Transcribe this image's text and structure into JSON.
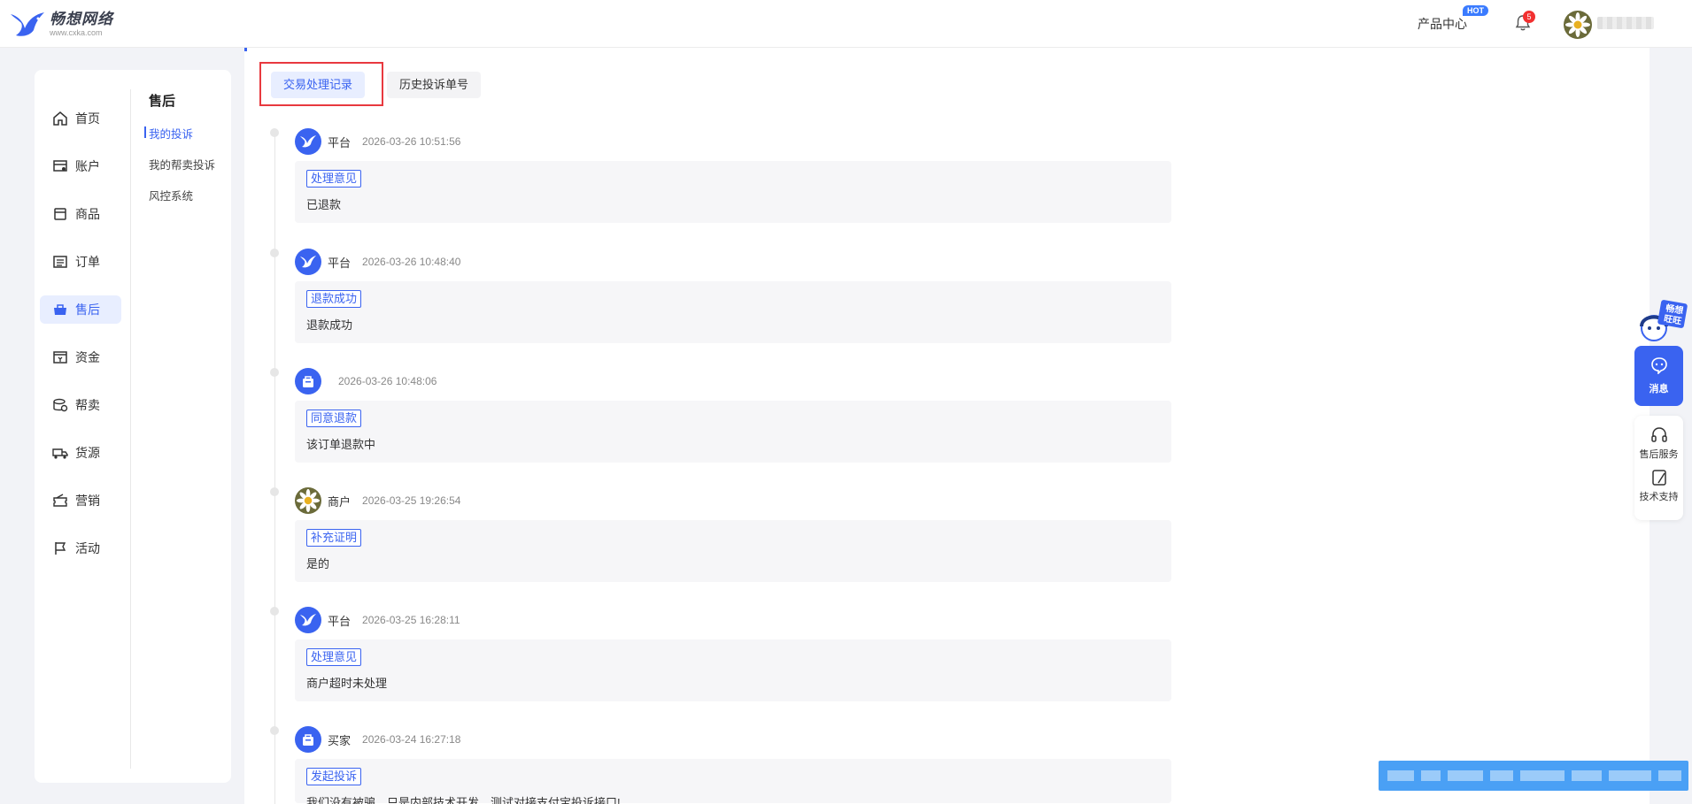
{
  "header": {
    "logo_name": "畅想网络",
    "logo_url": "www.cxka.com",
    "product_center": "产品中心",
    "hot_badge": "HOT",
    "notification_count": "5"
  },
  "sidebar": {
    "menu": [
      {
        "label": "首页",
        "icon": "home-icon"
      },
      {
        "label": "账户",
        "icon": "account-icon"
      },
      {
        "label": "商品",
        "icon": "goods-icon"
      },
      {
        "label": "订单",
        "icon": "order-icon"
      },
      {
        "label": "售后",
        "icon": "aftersale-icon",
        "active": true
      },
      {
        "label": "资金",
        "icon": "funds-icon"
      },
      {
        "label": "帮卖",
        "icon": "help-sell-icon"
      },
      {
        "label": "货源",
        "icon": "supply-icon"
      },
      {
        "label": "营销",
        "icon": "marketing-icon"
      },
      {
        "label": "活动",
        "icon": "flag-icon"
      }
    ],
    "sub_title": "售后",
    "sub_items": [
      "我的投诉",
      "我的帮卖投诉",
      "风控系统"
    ]
  },
  "tabs": {
    "active": "交易处理记录",
    "inactive": "历史投诉单号"
  },
  "timeline": [
    {
      "role": "平台",
      "time": "2026-03-26 10:51:56",
      "tag": "处理意见",
      "text": "已退款",
      "avatar": "platform"
    },
    {
      "role": "平台",
      "time": "2026-03-26 10:48:40",
      "tag": "退款成功",
      "text": "退款成功",
      "avatar": "platform"
    },
    {
      "role": "",
      "time": "2026-03-26 10:48:06",
      "tag": "同意退款",
      "text": "该订单退款中",
      "avatar": "bag"
    },
    {
      "role": "商户",
      "time": "2026-03-25 19:26:54",
      "tag": "补充证明",
      "text": "是的",
      "avatar": "flower"
    },
    {
      "role": "平台",
      "time": "2026-03-25 16:28:11",
      "tag": "处理意见",
      "text": "商户超时未处理",
      "avatar": "platform"
    },
    {
      "role": "买家",
      "time": "2026-03-24 16:27:18",
      "tag": "发起投诉",
      "text": "我们没有被骗，只是内部技术开发，测试对接支付宝投诉接口!",
      "avatar": "bag"
    }
  ],
  "float": {
    "mascot_text": "畅想旺旺",
    "message": "消息",
    "after_sale_service": "售后服务",
    "tech_support": "技术支持"
  },
  "colors": {
    "accent": "#3a63f0",
    "highlight_border": "#e8393f",
    "background": "#f2f3f7"
  }
}
